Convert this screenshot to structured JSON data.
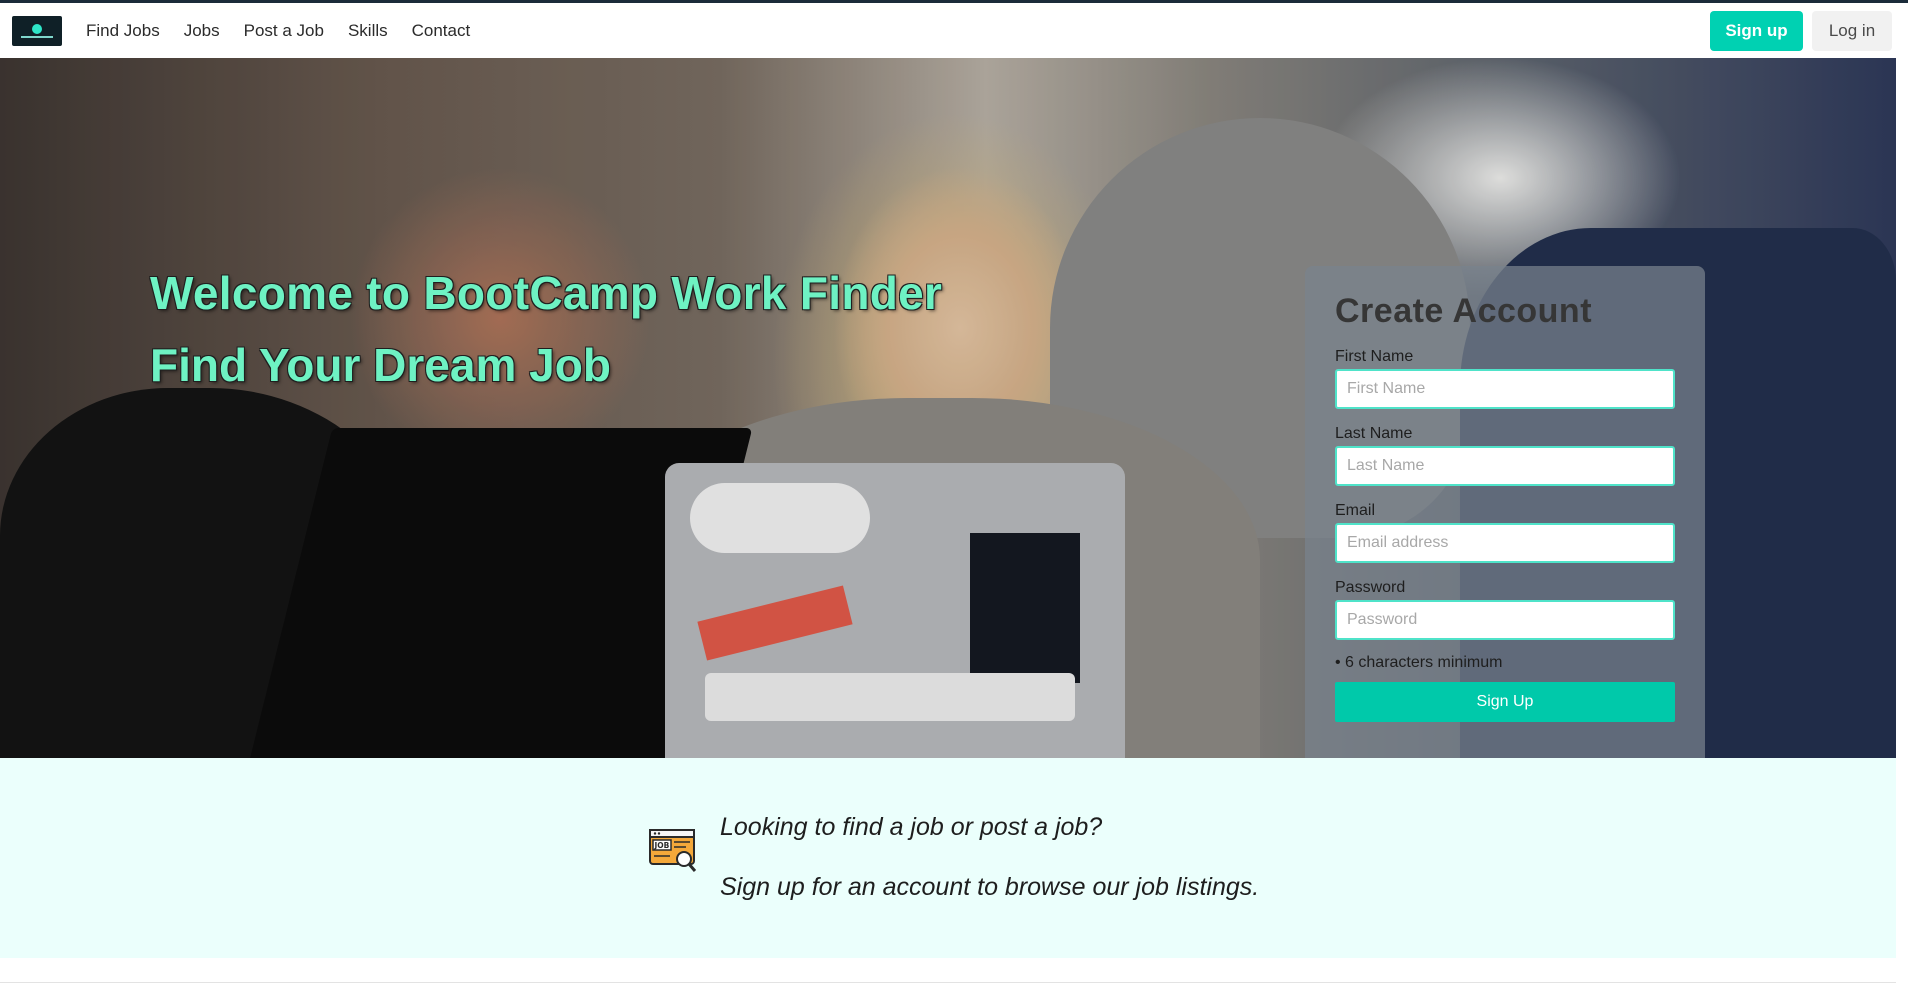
{
  "navbar": {
    "logo_alt": "BootCamp Work Finder logo",
    "links": [
      "Find Jobs",
      "Jobs",
      "Post a Job",
      "Skills",
      "Contact"
    ],
    "signup_label": "Sign up",
    "login_label": "Log in"
  },
  "hero": {
    "title": "Welcome to BootCamp Work Finder",
    "subtitle": "Find Your Dream Job"
  },
  "signup_form": {
    "title": "Create Account",
    "fields": [
      {
        "label": "First Name",
        "placeholder": "First Name"
      },
      {
        "label": "Last Name",
        "placeholder": "Last Name"
      },
      {
        "label": "Email",
        "placeholder": "Email address"
      },
      {
        "label": "Password",
        "placeholder": "Password"
      }
    ],
    "password_hint": "• 6 characters minimum",
    "submit_label": "Sign Up"
  },
  "info": {
    "icon_text": "JOB",
    "line1": "Looking to find a job or post a job?",
    "line2": "Sign up for an account to browse our job listings."
  },
  "colors": {
    "accent": "#00d1b2",
    "hero_text": "#6ef2c3",
    "info_background": "#ebfffc"
  }
}
